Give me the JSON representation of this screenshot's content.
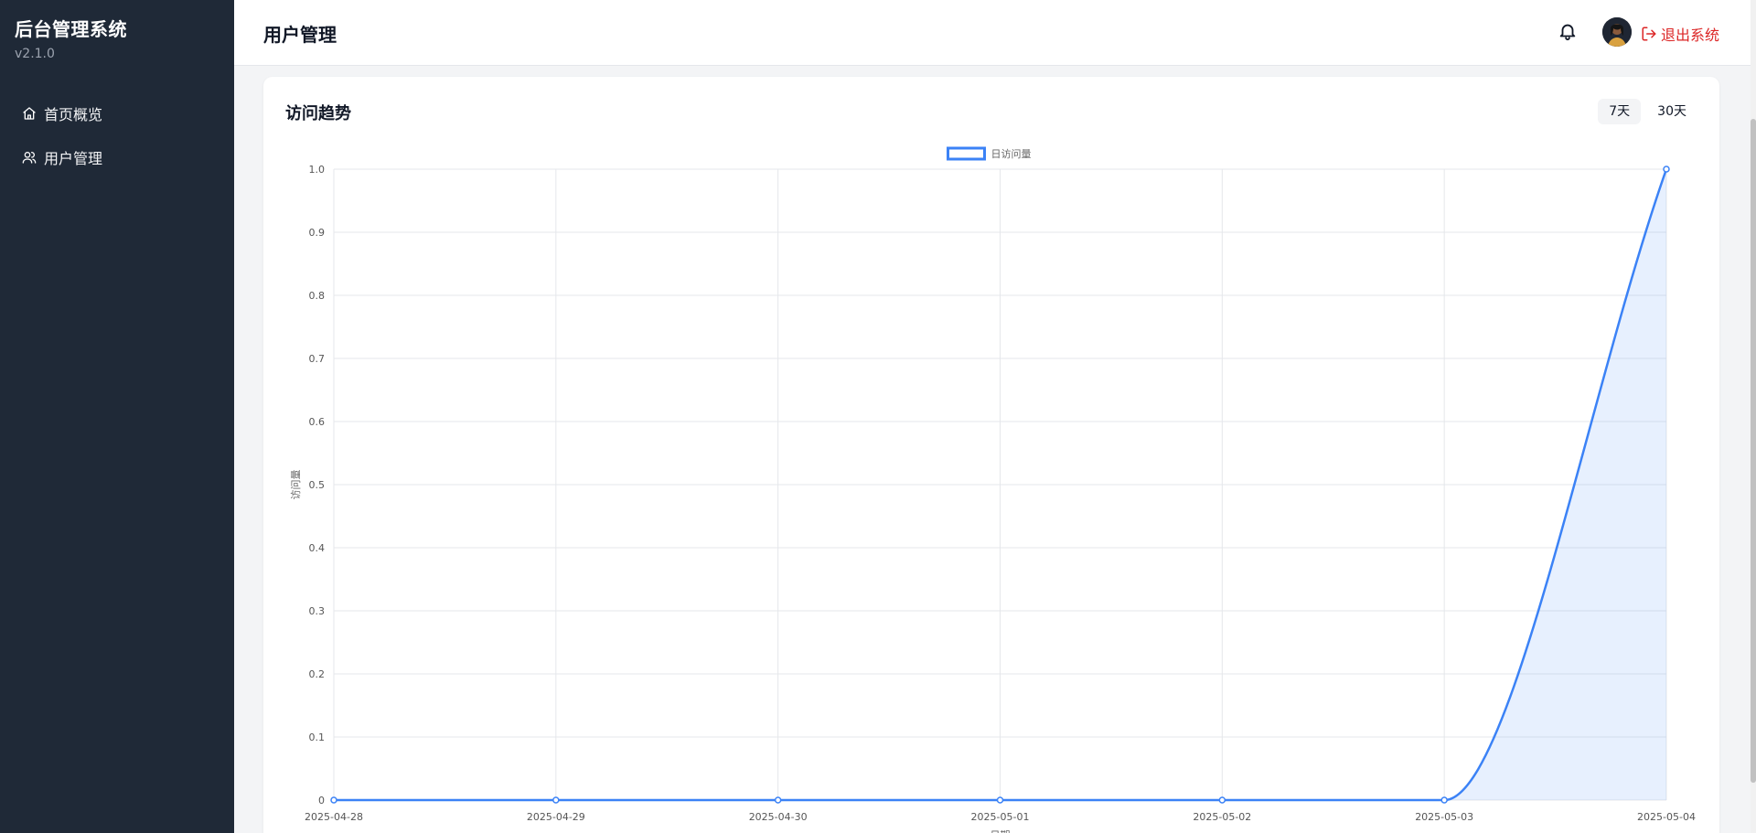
{
  "sidebar": {
    "title": "后台管理系统",
    "version": "v2.1.0",
    "items": [
      {
        "label": "首页概览",
        "icon": "home-icon"
      },
      {
        "label": "用户管理",
        "icon": "users-icon"
      }
    ]
  },
  "header": {
    "title": "用户管理",
    "notification_icon": "bell-icon",
    "logout_label": "退出系统",
    "logout_color": "#dc2626"
  },
  "card": {
    "title": "访问趋势",
    "range_options": [
      "7天",
      "30天"
    ],
    "selected_range": "7天"
  },
  "chart_data": {
    "type": "line",
    "title": "",
    "legend": "日访问量",
    "legend_position": "top-center",
    "xlabel": "日期",
    "ylabel": "访问量",
    "categories": [
      "2025-04-28",
      "2025-04-29",
      "2025-04-30",
      "2025-05-01",
      "2025-05-02",
      "2025-05-03",
      "2025-05-04"
    ],
    "series": [
      {
        "name": "日访问量",
        "values": [
          0,
          0,
          0,
          0,
          0,
          0,
          1
        ],
        "color": "#3b82f6"
      }
    ],
    "ylim": [
      0,
      1
    ],
    "yticks": [
      "0",
      "0.1",
      "0.2",
      "0.3",
      "0.4",
      "0.5",
      "0.6",
      "0.7",
      "0.8",
      "0.9",
      "1.0"
    ],
    "grid": true,
    "fill": true
  }
}
